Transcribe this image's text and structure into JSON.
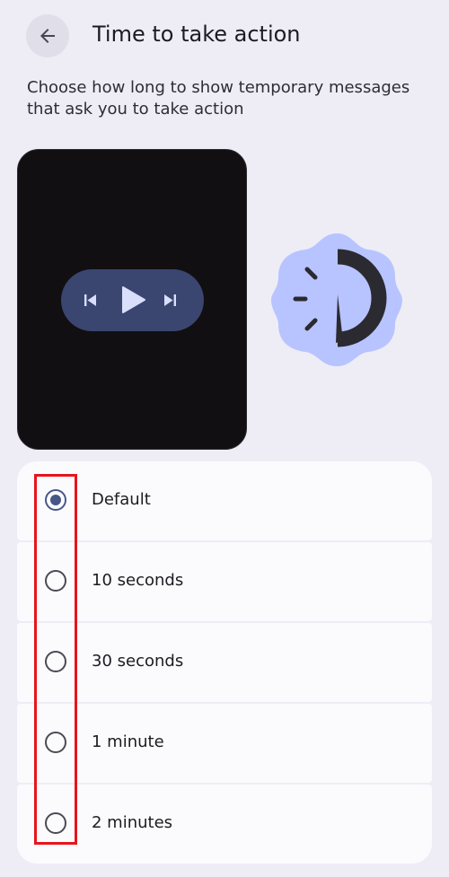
{
  "header": {
    "back_icon": "arrow-left-icon",
    "title": "Time to take action"
  },
  "description": "Choose how long to show temporary messages that ask you to take action",
  "preview": {
    "media_controls": [
      "skip-previous-icon",
      "play-icon",
      "skip-next-icon"
    ],
    "badge_icon": "timer-icon"
  },
  "options": [
    {
      "label": "Default",
      "selected": true
    },
    {
      "label": "10 seconds",
      "selected": false
    },
    {
      "label": "30 seconds",
      "selected": false
    },
    {
      "label": "1 minute",
      "selected": false
    },
    {
      "label": "2 minutes",
      "selected": false
    }
  ],
  "colors": {
    "background": "#eeedf6",
    "accent": "#475788",
    "highlight": "#e8141b",
    "badge": "#b8c4ff"
  }
}
